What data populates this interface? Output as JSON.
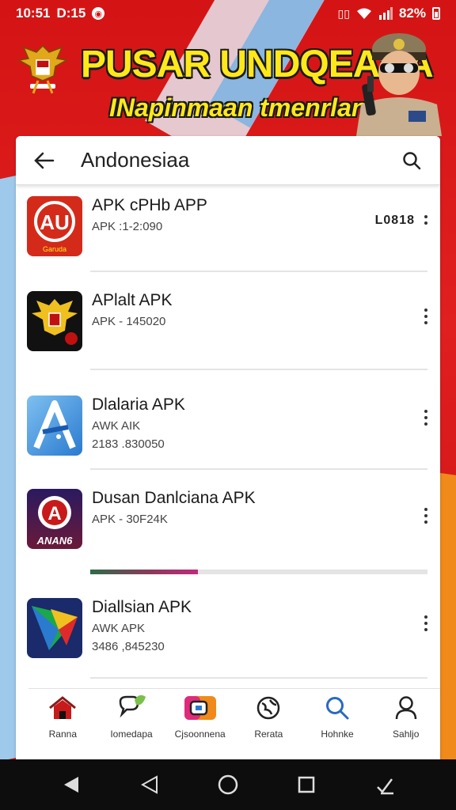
{
  "status_bar": {
    "time": "10:51",
    "extra": "D:15",
    "battery": "82%"
  },
  "banner": {
    "title": "PUSAR UNDQEANA",
    "subtitle": "INapinmaan tmenrlan",
    "emblem_caption": "Garuda Pancasila"
  },
  "search": {
    "query": "Andonesiaa"
  },
  "apps": [
    {
      "name": "APK cPHb APP",
      "meta": "APK :1-2:090",
      "meta2": "",
      "side": "L0818",
      "icon_text": "AU",
      "icon_sub": "Garuda"
    },
    {
      "name": "APlalt APK",
      "meta": "APK - 145020",
      "meta2": "",
      "side": "",
      "icon_text": "",
      "icon_sub": ""
    },
    {
      "name": "Dlalaria APK",
      "meta": "AWK AIK",
      "meta2": "2183 .830050",
      "side": "",
      "icon_text": "A",
      "icon_sub": ""
    },
    {
      "name": "Dusan Danlciana APK",
      "meta": "APK - 30F24K",
      "meta2": "",
      "side": "",
      "icon_text": "A",
      "icon_sub": "ANAN6"
    },
    {
      "name": "Diallsian APK",
      "meta": "AWK APK",
      "meta2": "3486 ,845230",
      "side": "",
      "icon_text": "",
      "icon_sub": ""
    }
  ],
  "download_progress": 0.32,
  "bottom_nav": [
    {
      "label": "Ranna",
      "icon": "home-icon"
    },
    {
      "label": "Iomedapa",
      "icon": "chat-icon"
    },
    {
      "label": "Cjsoonnena",
      "icon": "apps-icon"
    },
    {
      "label": "Rerata",
      "icon": "globe-icon"
    },
    {
      "label": "Hohnke",
      "icon": "search-icon"
    },
    {
      "label": "Sahljo",
      "icon": "profile-icon"
    }
  ],
  "colors": {
    "background_red": "#d41414",
    "banner_text": "#ffe81a",
    "accent_blue": "#3a86d8"
  }
}
